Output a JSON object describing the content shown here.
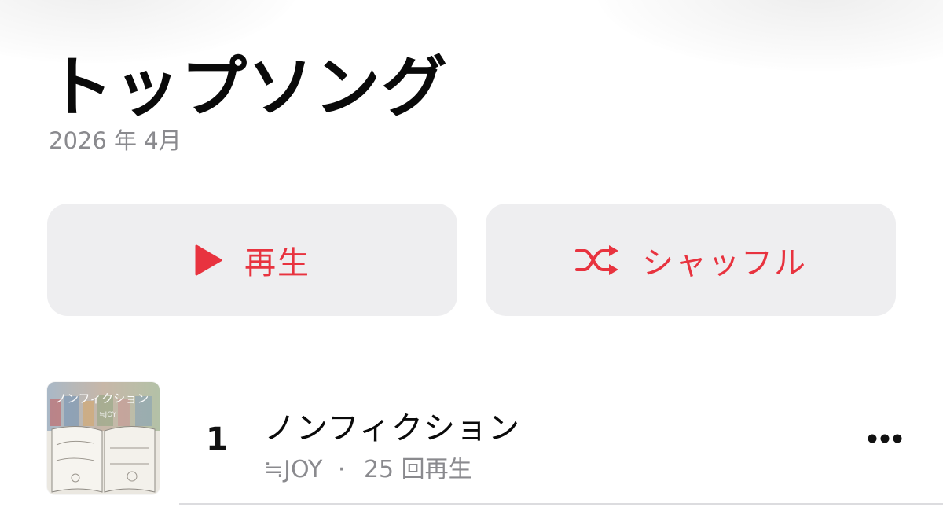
{
  "header": {
    "title": "トップソング",
    "subtitle": "2026 年 4月"
  },
  "actions": {
    "play_label": "再生",
    "shuffle_label": "シャッフル",
    "accent_color": "#e8333f",
    "button_background": "#eeeef0"
  },
  "songs": [
    {
      "rank": "1",
      "title": "ノンフィクション",
      "artwork_text": "ノンフィクション",
      "artwork_artist_text": "≒JOY",
      "artist": "≒JOY",
      "separator": "·",
      "plays": "25 回再生"
    }
  ],
  "icons": {
    "play": "play-triangle-icon",
    "shuffle": "shuffle-icon",
    "more": "more-ellipsis-icon"
  }
}
